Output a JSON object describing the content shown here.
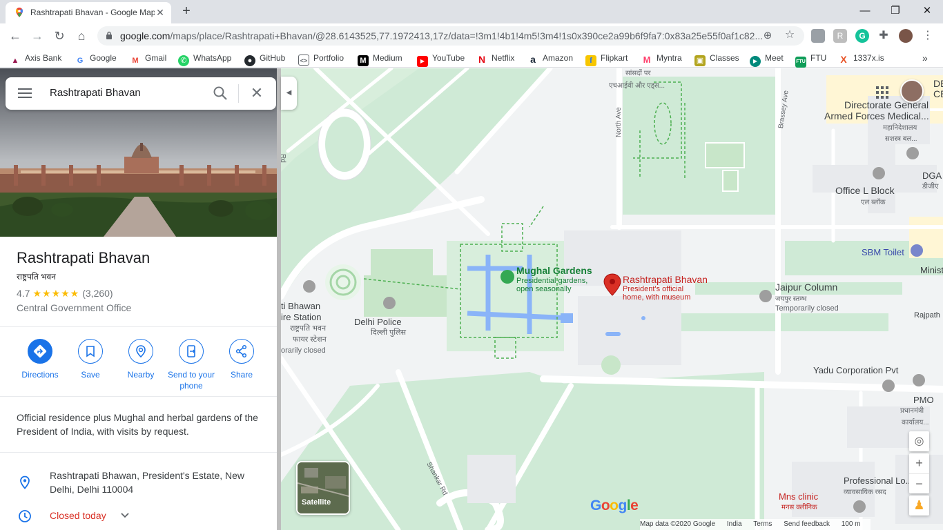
{
  "browser": {
    "tab_title": "Rashtrapati Bhavan - Google Maps",
    "tab_close": "✕",
    "new_tab": "+",
    "url_host": "google.com",
    "url_path": "/maps/place/Rashtrapati+Bhavan/@28.6143525,77.1972413,17z/data=!3m1!4b1!4m5!3m4!1s0x390ce2a99b6f9fa7:0x83a25e55f0af1c82...",
    "window_controls": {
      "minimize": "—",
      "restore": "❐",
      "close": "✕"
    }
  },
  "bookmarks": [
    {
      "label": "Axis Bank",
      "color": "#97144d",
      "glyph": "A"
    },
    {
      "label": "Google",
      "color": "#4285f4",
      "glyph": "G"
    },
    {
      "label": "Gmail",
      "color": "#ea4335",
      "glyph": "M"
    },
    {
      "label": "WhatsApp",
      "color": "#25d366",
      "glyph": "✆"
    },
    {
      "label": "GitHub",
      "color": "#24292e",
      "glyph": "◉"
    },
    {
      "label": "Portfolio",
      "color": "#5f6368",
      "glyph": "▤"
    },
    {
      "label": "Medium",
      "color": "#000000",
      "glyph": "M"
    },
    {
      "label": "YouTube",
      "color": "#ff0000",
      "glyph": "▶"
    },
    {
      "label": "Netflix",
      "color": "#e50914",
      "glyph": "N"
    },
    {
      "label": "Amazon",
      "color": "#232f3e",
      "glyph": "a"
    },
    {
      "label": "Flipkart",
      "color": "#f7c600",
      "glyph": "f"
    },
    {
      "label": "Myntra",
      "color": "#ff3f6c",
      "glyph": "M"
    },
    {
      "label": "Classes",
      "color": "#b3a51f",
      "glyph": "▣"
    },
    {
      "label": "Meet",
      "color": "#00897b",
      "glyph": "▶"
    },
    {
      "label": "FTU",
      "color": "#0f9d58",
      "glyph": "FTU"
    },
    {
      "label": "1337x.is",
      "color": "#e8562a",
      "glyph": "X"
    }
  ],
  "bookmarks_more": "»",
  "search": {
    "query": "Rashtrapati Bhavan"
  },
  "place": {
    "name": "Rashtrapati Bhavan",
    "name_hindi": "राष्ट्रपति भवन",
    "rating": "4.7",
    "stars": "★★★★★",
    "review_count": "(3,260)",
    "category": "Central Government Office",
    "description": "Official residence plus Mughal and herbal gardens of the President of India, with visits by request.",
    "address": "Rashtrapati Bhawan, President's Estate, New Delhi, Delhi 110004",
    "hours": "Closed today"
  },
  "actions": [
    {
      "label": "Directions"
    },
    {
      "label": "Save"
    },
    {
      "label": "Nearby"
    },
    {
      "label": "Send to your phone"
    },
    {
      "label": "Share"
    }
  ],
  "map": {
    "labels": {
      "mughal_title": "Mughal Gardens",
      "mughal_sub1": "Presidential gardens,",
      "mughal_sub2": "open seasonally",
      "rb_title": "Rashtrapati Bhavan",
      "rb_sub1": "President's official",
      "rb_sub2": "home, with museum",
      "delhi_police": "Delhi Police",
      "delhi_police_hi": "दिल्ली पुलिस",
      "fire1": "ti Bhawan",
      "fire2": "ire Station",
      "fire3": "राष्ट्रपति भवन",
      "fire4": "फायर स्टेशन",
      "fire5": "orarily closed",
      "jaipur": "Jaipur Column",
      "jaipur_hi": "जयपुर स्तम्भ",
      "jaipur_closed": "Temporarily closed",
      "dgafms1": "Directorate General",
      "dgafms2": "Armed Forces Medical...",
      "dgafms3": "महानिदेशालय",
      "dgafms4": "सशस्त्र बल...",
      "office_l": "Office L Block",
      "office_l_hi": "एल ब्लॉक",
      "sbm": "SBM Toilet",
      "minist": "Minist",
      "rajpath": "Rajpath",
      "yadu": "Yadu Corporation Pvt",
      "pmo": "PMO",
      "pmo_hi1": "प्रधानमंत्री",
      "pmo_hi2": "कार्यालय...",
      "prof": "Professional Lo...cs",
      "prof_hi": "व्यावसायिक रसद",
      "mns": "Mns clinic",
      "mns_hi": "मनस क्लीनिक",
      "north_ave": "North Ave",
      "brassey": "Brassey Ave",
      "shankar": "Shankar Rd",
      "top_hi": "सांसदों पर",
      "top_hi2": "एचआईवी और एड्स...",
      "dgafms_top": "DE",
      "dgafms_top2": "CE",
      "dga": "DGA",
      "dga_hi": "डीजीए",
      "left_rd": "Rd"
    },
    "satellite_label": "Satellite",
    "google": "Google",
    "footer": {
      "data": "Map data ©2020 Google",
      "country": "India",
      "terms": "Terms",
      "feedback": "Send feedback",
      "scale": "100 m"
    },
    "zoom_in": "+",
    "zoom_out": "−"
  },
  "colors": {
    "accent": "#1a73e8",
    "closed": "#d93025",
    "park": "#c8e6c9",
    "road": "#ffffff",
    "pin": "#d93025"
  }
}
